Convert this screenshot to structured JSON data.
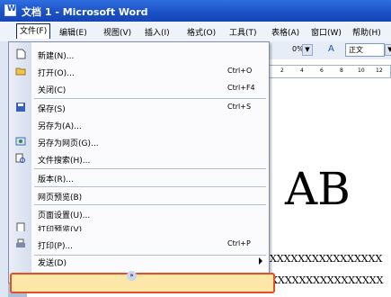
{
  "window": {
    "title": "文档 1 - Microsoft Word"
  },
  "menubar": {
    "items": [
      "文件(F)",
      "编辑(E)",
      "视图(V)",
      "插入(I)",
      "格式(O)",
      "工具(T)",
      "表格(A)",
      "窗口(W)",
      "帮助(H)"
    ]
  },
  "toolbar": {
    "zoom": "0%",
    "style": "正文"
  },
  "ruler": {
    "ticks": [
      "2",
      "4",
      "6",
      "8",
      "10",
      "12"
    ]
  },
  "document": {
    "big_text": "AB",
    "x_line_1": "XXXXXXXXXXXXXXXX",
    "x_line_2": "XXXXXXXXXXXXXXXXXXXXX"
  },
  "file_menu": {
    "items": [
      {
        "label": "新建(N)...",
        "shortcut": ""
      },
      {
        "label": "打开(O)...",
        "shortcut": "Ctrl+O"
      },
      {
        "label": "关闭(C)",
        "shortcut": "Ctrl+F4"
      },
      {
        "label": "保存(S)",
        "shortcut": "Ctrl+S"
      },
      {
        "label": "另存为(A)...",
        "shortcut": ""
      },
      {
        "label": "另存为网页(G)...",
        "shortcut": ""
      },
      {
        "label": "文件搜索(H)...",
        "shortcut": ""
      },
      {
        "label": "版本(R)...",
        "shortcut": ""
      },
      {
        "label": "网页预览(B)",
        "shortcut": ""
      },
      {
        "label": "页面设置(U)...",
        "shortcut": ""
      },
      {
        "label": "打印预览(V)",
        "shortcut": ""
      },
      {
        "label": "打印(P)...",
        "shortcut": "Ctrl+P"
      },
      {
        "label": "发送(D)",
        "shortcut": ""
      }
    ],
    "highlighted_item": "打印(P)...",
    "highlight_color": "#e2502a"
  }
}
